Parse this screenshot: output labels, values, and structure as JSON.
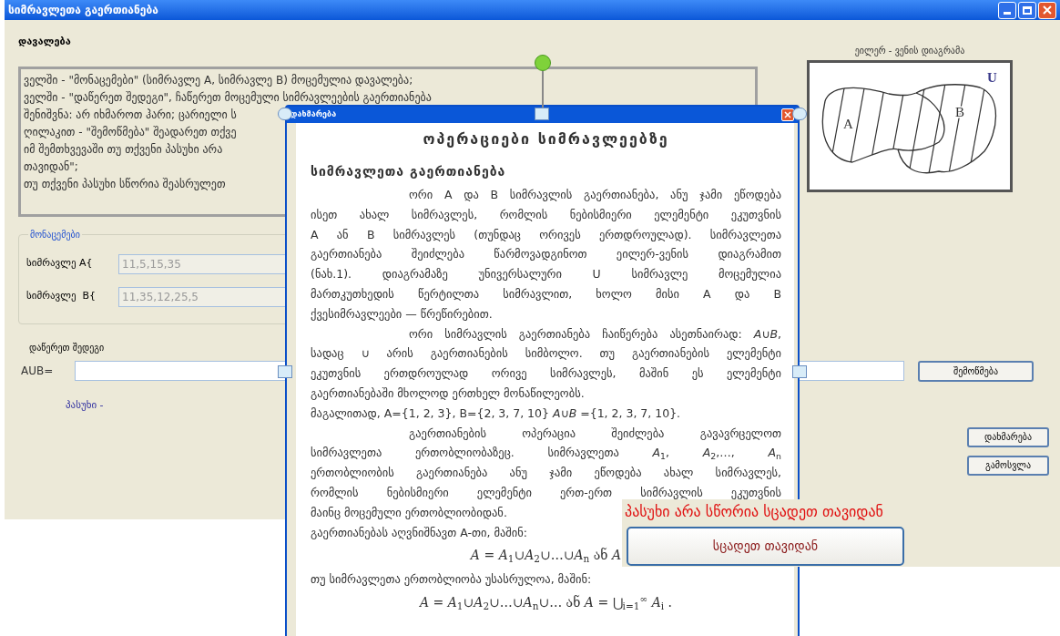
{
  "window": {
    "title": "სიმრავლეთა გაერთიანება"
  },
  "task": {
    "label": "დავალება",
    "lines": [
      "ველში - \"მონაცემები\" (სიმრავლე A, სიმრავლე B) მოცემულია დავალება;",
      "ველში - \"დაწერეთ შედეგი\", ჩაწერეთ მოცემული სიმრავლეების გაერთიანება",
      "შენიშვნა: არ იხმაროთ ჰარი; ცარიელი ს",
      "ღილაკით  - \"შემოწმება\" შეადარეთ თქვე",
      "იმ შემთხვევაში თუ თქვენი პასუხი არა",
      "თავიდან\";",
      "თუ თქვენი პასუხი სწორია შეასრულეთ"
    ]
  },
  "data_group": {
    "title": "მონაცემები",
    "fields": [
      {
        "label": "სიმრავლე A{",
        "value": "11,5,15,35"
      },
      {
        "label": "სიმრავლე  B{",
        "value": "11,35,12,25,5"
      }
    ]
  },
  "result": {
    "label": "დაწერეთ შედეგი",
    "prefix": "AUB=",
    "check_button": "შემოწმება",
    "answer_label": "პასუხი -"
  },
  "diagram": {
    "title": "ეილერ - ვენის დიაგრამა",
    "labels": [
      "A",
      "B",
      "U"
    ]
  },
  "buttons": [
    "დახმარება",
    "გამოსვლა"
  ],
  "help_window": {
    "title": "დახმარება",
    "heading": "ოპერაციები სიმრავლეებზე",
    "subheading": "სიმრავლეთა გაერთიანება",
    "lines": [
      {
        "kind": "first",
        "text": "ორი A და B სიმრავლის გაერთიანება, ანუ ჯამი ეწოდება"
      },
      {
        "kind": "full",
        "text": "ისეთ ახალ სიმრავლეს, რომლის ნებისმიერი ელემენტი ეკუთვნის"
      },
      {
        "kind": "full",
        "text": "A ან B სიმრავლეს (თუნდაც ორივეს ერთდროულად). სიმრავლეთა"
      },
      {
        "kind": "full",
        "text": "გაერთიანება შეიძლება წარმოვადგინოთ ეილერ-ვენის დიაგრამით"
      },
      {
        "kind": "full",
        "text": "(ნახ.1). დიაგრამაზე უნივერსალური U სიმრავლე მოცემულია"
      },
      {
        "kind": "full",
        "text": "მართკუთხედის წერტილთა სიმრავლით, ხოლო მისი A და B"
      },
      {
        "kind": "last",
        "text": "ქვესიმრავლეები — წრეწირებით."
      },
      {
        "kind": "first",
        "text": "ორი სიმრავლის გაერთიანება ჩაიწერება ასეთნაირად: *A*∪*B*,"
      },
      {
        "kind": "full",
        "text": "სადაც ∪ არის გაერთიანების სიმბოლო. თუ გაერთიანების ელემენტი"
      },
      {
        "kind": "full",
        "text": "ეკუთვნის ერთდროულად ორივე სიმრავლეს, მაშინ ეს ელემენტი"
      },
      {
        "kind": "last",
        "text": "გაერთიანებაში მხოლოდ ერთხელ მონაწილეობს."
      },
      {
        "kind": "last",
        "text": "მაგალითად, A={1, 2, 3}, B={2, 3, 7, 10}  *A*∪*B* ={1, 2, 3, 7, 10}."
      },
      {
        "kind": "first",
        "text": "გაერთიანების ოპერაცია შეიძლება გავავრცელოთ"
      },
      {
        "kind": "full",
        "text": "სიმრავლეთა ერთობლიობაზეც. სიმრავლეთა *A*$_{1}$, *A*$_{2}$,…, *A*$_{n}$"
      },
      {
        "kind": "full",
        "text": "ერთობლიობის გაერთიანება ანუ ჯამი ეწოდება ახალ სიმრავლეს,"
      },
      {
        "kind": "full",
        "text": "რომლის ნებისმიერი ელემენტი ერთ-ერთ სიმრავლის ეკუთვნის"
      },
      {
        "kind": "last",
        "text": "მაინც მოცემული ერთობლიობიდან."
      },
      {
        "kind": "last",
        "text": "გაერთიანებას აღვნიშნავთ A-თი, მაშინ:"
      },
      {
        "kind": "formula",
        "text": "*A* = *A*$_{1}$∪*A*$_{2}$∪…∪*A*$_{n}$  ან  *A*"
      },
      {
        "kind": "last",
        "text": "თუ სიმრავლეთა ერთობლიობა უსასრულოა, მაშინ:"
      },
      {
        "kind": "formula",
        "text": "*A* = *A*$_{1}$∪*A*$_{2}$∪…∪*A*$_{n}$∪…   ან    *A* = ⋃$_{i=1}$$^{∞}$ *A*$_{i}$ ."
      }
    ]
  },
  "error_message": {
    "text": "პასუხი არა სწორია  სცადეთ თავიდან",
    "button": "სცადეთ თავიდან"
  }
}
